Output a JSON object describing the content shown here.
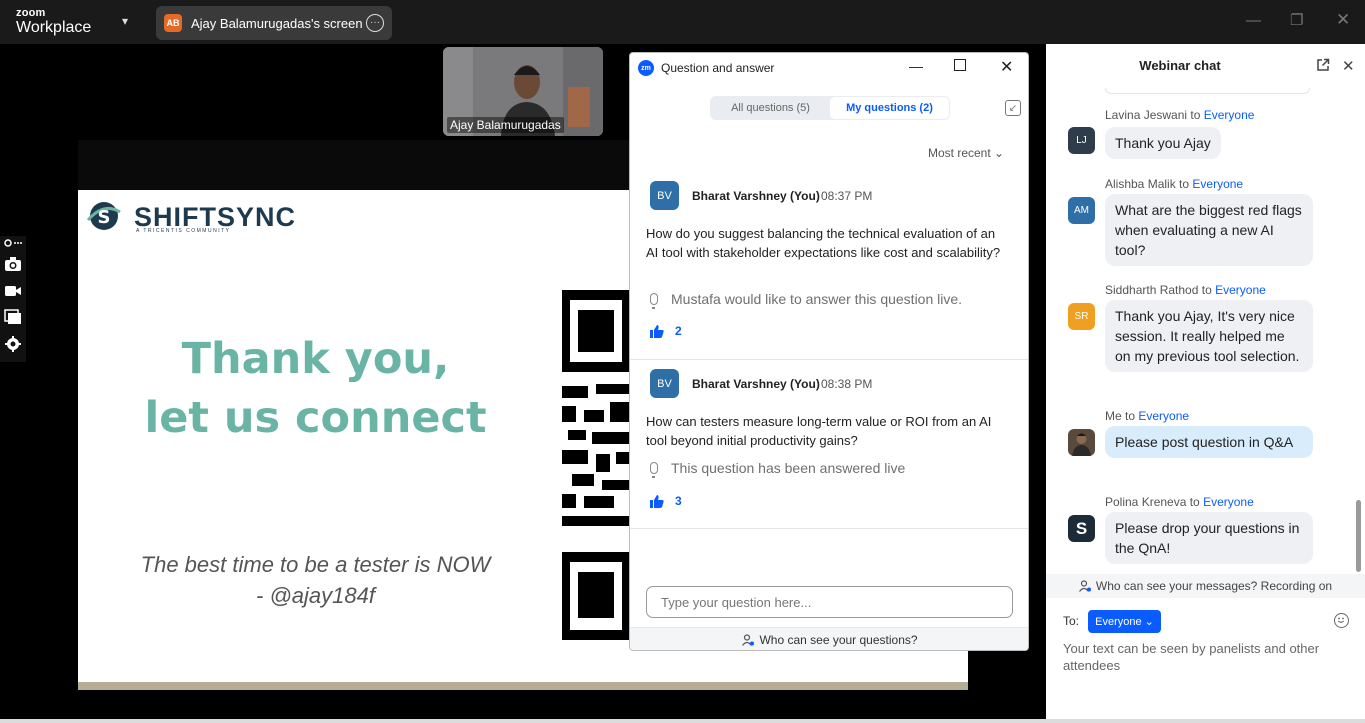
{
  "topbar": {
    "brand_small": "zoom",
    "brand_big": "Workplace",
    "screen_tab_initials": "AB",
    "screen_tab_label": "Ajay Balamurugadas's screen",
    "more_glyph": "•••"
  },
  "slide": {
    "logo_text": "SHIFTSYNC",
    "logo_sub": "A TRICENTIS COMMUNITY",
    "thanks_line1": "Thank you,",
    "thanks_line2": "let us connect",
    "quote_line1": "The best time to be a tester is NOW",
    "quote_line2": "- @ajay184f"
  },
  "thumbnail": {
    "name": "Ajay Balamurugadas"
  },
  "qa": {
    "logo": "zm",
    "title": "Question and answer",
    "tabs": [
      {
        "label": "All questions (5)",
        "active": false
      },
      {
        "label": "My questions (2)",
        "active": true
      }
    ],
    "sort": "Most recent ⌄",
    "questions": [
      {
        "initials": "BV",
        "author": "Bharat Varshney (You)",
        "time": "08:37 PM",
        "text": "How do you suggest balancing the technical evaluation of an AI tool with stakeholder expectations like cost and scalability?",
        "live_status": "Mustafa would like to answer this question live.",
        "likes": "2"
      },
      {
        "initials": "BV",
        "author": "Bharat Varshney (You)",
        "time": "08:38 PM",
        "text": "How can testers measure long-term value or ROI from an AI tool beyond initial productivity gains?",
        "live_status": "This question has been answered live",
        "likes": "3"
      }
    ],
    "input_placeholder": "Type your question here...",
    "footer": "Who can see your questions?"
  },
  "chat": {
    "title": "Webinar chat",
    "messages": [
      {
        "sender": "Lavina Jeswani",
        "to_word": " to ",
        "recipient": "Everyone",
        "initials": "LJ",
        "avatar_color": "#2e3c4c",
        "text": "Thank you Ajay"
      },
      {
        "sender": "Alishba Malik",
        "to_word": " to ",
        "recipient": "Everyone",
        "initials": "AM",
        "avatar_color": "#2d6fa6",
        "text": "What are the biggest red flags when evaluating a new AI tool?"
      },
      {
        "sender": "Siddharth Rathod",
        "to_word": " to ",
        "recipient": "Everyone",
        "initials": "SR",
        "avatar_color": "#f0a020",
        "text": "Thank you Ajay, It's very nice session. It really helped me on my previous tool selection."
      },
      {
        "sender": "Me",
        "to_word": " to ",
        "recipient": "Everyone",
        "initials": "",
        "avatar_color": "#5a4a3e",
        "text": "Please post question in Q&A"
      },
      {
        "sender": "Polina Kreneva",
        "to_word": " to ",
        "recipient": "Everyone",
        "initials": "S",
        "avatar_color": "#1d2a38",
        "text": "Please drop your questions in the QnA!"
      }
    ],
    "visibility": "Who can see your messages? Recording on",
    "to_label": "To:",
    "recipient_button": "Everyone ⌄",
    "input_placeholder": "Your text can be seen by panelists and other attendees"
  }
}
